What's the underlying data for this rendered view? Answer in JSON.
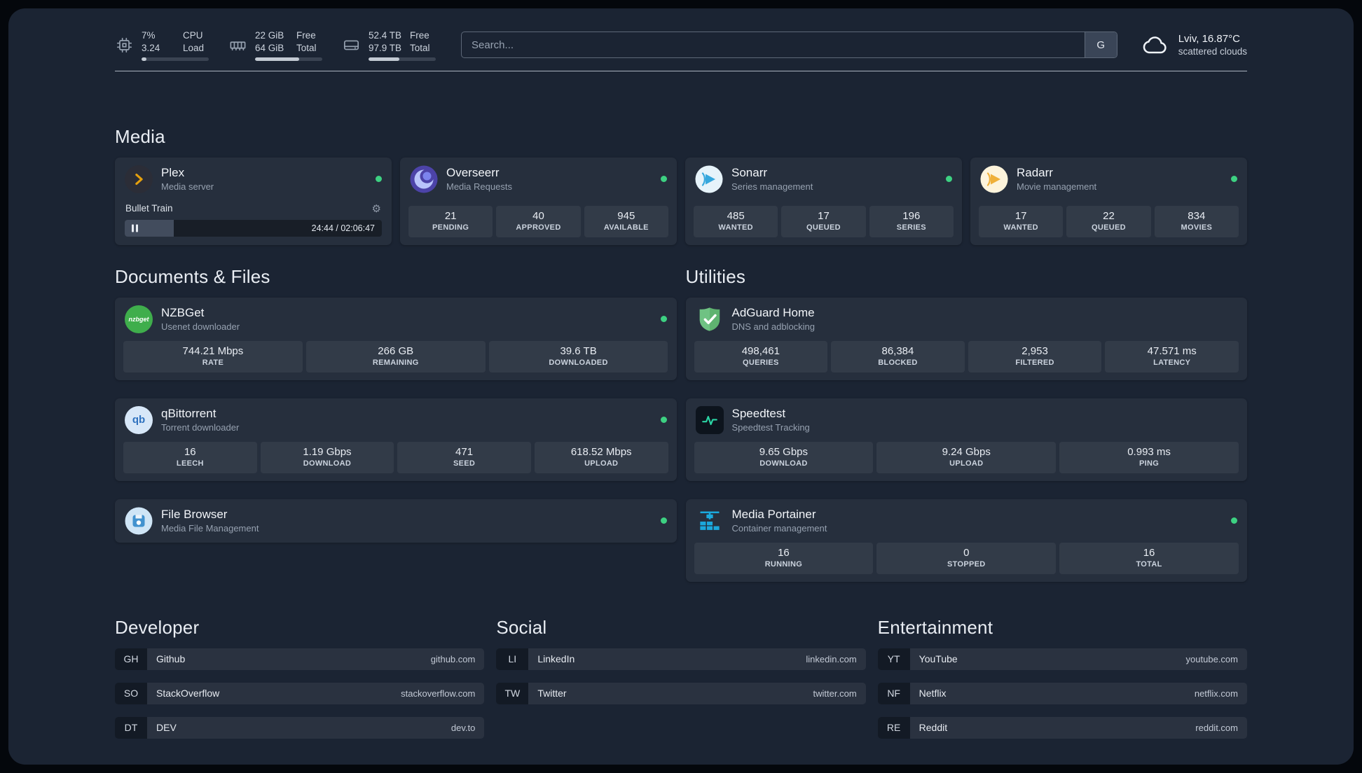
{
  "theme": {
    "panel_bg": "#1b2433",
    "card_bg": "#262f42",
    "status_green": "#3dd182",
    "plex_gold": "#e5a00d",
    "portainer_blue": "#1ba8dc",
    "speedtest_green": "#2bd4a4"
  },
  "topbar": {
    "cpu": {
      "value1": "7%",
      "label1": "CPU",
      "value2": "3.24",
      "label2": "Load",
      "percent": 7
    },
    "memory": {
      "value1": "22 GiB",
      "label1": "Free",
      "value2": "64 GiB",
      "label2": "Total",
      "percent": 66
    },
    "disk": {
      "value1": "52.4 TB",
      "label1": "Free",
      "value2": "97.9 TB",
      "label2": "Total",
      "percent": 46
    },
    "search": {
      "placeholder": "Search...",
      "provider": "G"
    },
    "weather": {
      "location": "Lviv, 16.87°C",
      "condition": "scattered clouds"
    }
  },
  "media": {
    "heading": "Media",
    "plex": {
      "title": "Plex",
      "subtitle": "Media server",
      "online": true,
      "now_playing": "Bullet Train",
      "time": "24:44 / 02:06:47",
      "progress_percent": 19
    },
    "overseerr": {
      "title": "Overseerr",
      "subtitle": "Media Requests",
      "online": true,
      "stats": [
        {
          "value": "21",
          "label": "PENDING"
        },
        {
          "value": "40",
          "label": "APPROVED"
        },
        {
          "value": "945",
          "label": "AVAILABLE"
        }
      ]
    },
    "sonarr": {
      "title": "Sonarr",
      "subtitle": "Series management",
      "online": true,
      "stats": [
        {
          "value": "485",
          "label": "WANTED"
        },
        {
          "value": "17",
          "label": "QUEUED"
        },
        {
          "value": "196",
          "label": "SERIES"
        }
      ]
    },
    "radarr": {
      "title": "Radarr",
      "subtitle": "Movie management",
      "online": true,
      "stats": [
        {
          "value": "17",
          "label": "WANTED"
        },
        {
          "value": "22",
          "label": "QUEUED"
        },
        {
          "value": "834",
          "label": "MOVIES"
        }
      ]
    }
  },
  "documents": {
    "heading": "Documents & Files",
    "nzbget": {
      "title": "NZBGet",
      "subtitle": "Usenet downloader",
      "online": true,
      "stats": [
        {
          "value": "744.21 Mbps",
          "label": "RATE"
        },
        {
          "value": "266 GB",
          "label": "REMAINING"
        },
        {
          "value": "39.6 TB",
          "label": "DOWNLOADED"
        }
      ]
    },
    "qbittorrent": {
      "title": "qBittorrent",
      "subtitle": "Torrent downloader",
      "online": true,
      "stats": [
        {
          "value": "16",
          "label": "LEECH"
        },
        {
          "value": "1.19 Gbps",
          "label": "DOWNLOAD"
        },
        {
          "value": "471",
          "label": "SEED"
        },
        {
          "value": "618.52 Mbps",
          "label": "UPLOAD"
        }
      ]
    },
    "filebrowser": {
      "title": "File Browser",
      "subtitle": "Media File Management",
      "online": true
    }
  },
  "utilities": {
    "heading": "Utilities",
    "adguard": {
      "title": "AdGuard Home",
      "subtitle": "DNS and adblocking",
      "stats": [
        {
          "value": "498,461",
          "label": "QUERIES"
        },
        {
          "value": "86,384",
          "label": "BLOCKED"
        },
        {
          "value": "2,953",
          "label": "FILTERED"
        },
        {
          "value": "47.571 ms",
          "label": "LATENCY"
        }
      ]
    },
    "speedtest": {
      "title": "Speedtest",
      "subtitle": "Speedtest Tracking",
      "stats": [
        {
          "value": "9.65 Gbps",
          "label": "DOWNLOAD"
        },
        {
          "value": "9.24 Gbps",
          "label": "UPLOAD"
        },
        {
          "value": "0.993 ms",
          "label": "PING"
        }
      ]
    },
    "portainer": {
      "title": "Media Portainer",
      "subtitle": "Container management",
      "online": true,
      "stats": [
        {
          "value": "16",
          "label": "RUNNING"
        },
        {
          "value": "0",
          "label": "STOPPED"
        },
        {
          "value": "16",
          "label": "TOTAL"
        }
      ]
    }
  },
  "bookmarks": {
    "developer": {
      "heading": "Developer",
      "items": [
        {
          "abbr": "GH",
          "name": "Github",
          "domain": "github.com"
        },
        {
          "abbr": "SO",
          "name": "StackOverflow",
          "domain": "stackoverflow.com"
        },
        {
          "abbr": "DT",
          "name": "DEV",
          "domain": "dev.to"
        }
      ]
    },
    "social": {
      "heading": "Social",
      "items": [
        {
          "abbr": "LI",
          "name": "LinkedIn",
          "domain": "linkedin.com"
        },
        {
          "abbr": "TW",
          "name": "Twitter",
          "domain": "twitter.com"
        }
      ]
    },
    "entertainment": {
      "heading": "Entertainment",
      "items": [
        {
          "abbr": "YT",
          "name": "YouTube",
          "domain": "youtube.com"
        },
        {
          "abbr": "NF",
          "name": "Netflix",
          "domain": "netflix.com"
        },
        {
          "abbr": "RE",
          "name": "Reddit",
          "domain": "reddit.com"
        }
      ]
    }
  }
}
